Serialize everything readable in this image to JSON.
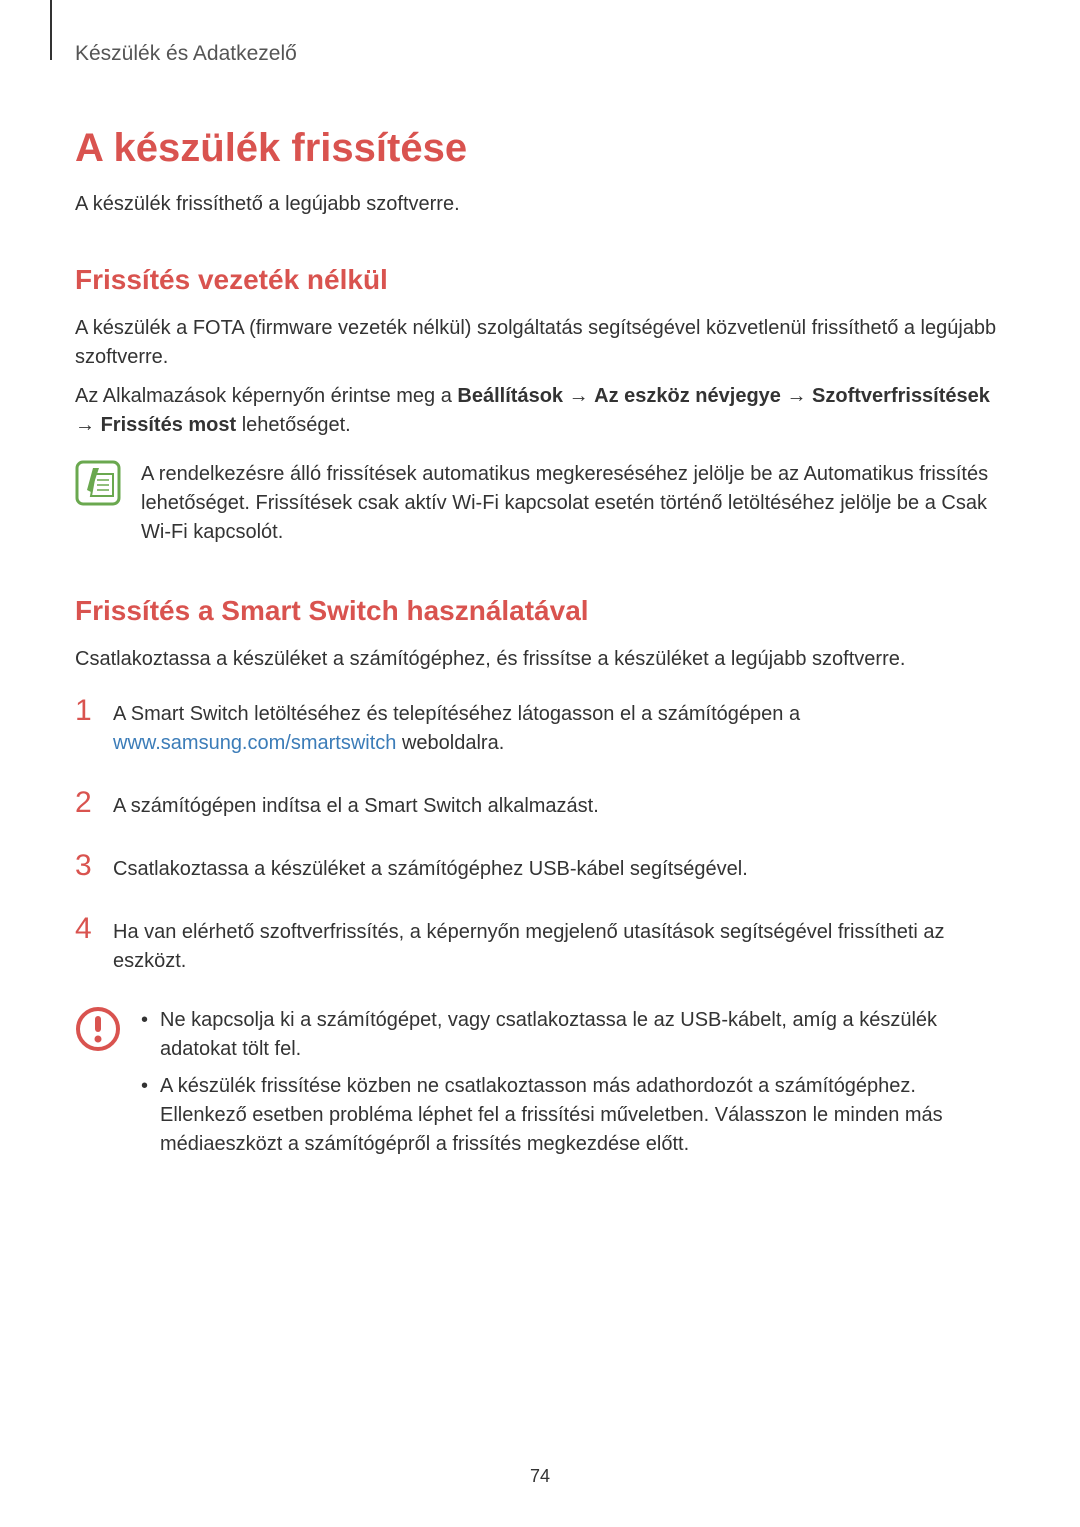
{
  "header": {
    "section": "Készülék és Adatkezelő"
  },
  "title": "A készülék frissítése",
  "intro": "A készülék frissíthető a legújabb szoftverre.",
  "section1": {
    "title": "Frissítés vezeték nélkül",
    "para1": "A készülék a FOTA (firmware vezeték nélkül) szolgáltatás segítségével közvetlenül frissíthető a legújabb szoftverre.",
    "para2_part1": "Az Alkalmazások képernyőn érintse meg a ",
    "para2_bold1": "Beállítások",
    "para2_arrow1": " → ",
    "para2_bold2": "Az eszköz névjegye",
    "para2_arrow2": " → ",
    "para2_bold3": "Szoftverfrissítések",
    "para2_arrow3": " → ",
    "para2_bold4": "Frissítés most",
    "para2_part2": " lehetőséget.",
    "note_part1": "A rendelkezésre álló frissítések automatikus megkereséséhez jelölje be az ",
    "note_bold1": "Automatikus frissítés",
    "note_part2": " lehetőséget. Frissítések csak aktív Wi-Fi kapcsolat esetén történő letöltéséhez jelölje be a ",
    "note_bold2": "Csak Wi-Fi",
    "note_part3": " kapcsolót."
  },
  "section2": {
    "title": "Frissítés a Smart Switch használatával",
    "para1": "Csatlakoztassa a készüléket a számítógéphez, és frissítse a készüléket a legújabb szoftverre.",
    "steps": [
      {
        "num": "1",
        "text_part1": "A Smart Switch letöltéséhez és telepítéséhez látogasson el a számítógépen a ",
        "link": "www.samsung.com/smartswitch",
        "text_part2": " weboldalra."
      },
      {
        "num": "2",
        "text": "A számítógépen indítsa el a Smart Switch alkalmazást."
      },
      {
        "num": "3",
        "text": "Csatlakoztassa a készüléket a számítógéphez USB-kábel segítségével."
      },
      {
        "num": "4",
        "text": "Ha van elérhető szoftverfrissítés, a képernyőn megjelenő utasítások segítségével frissítheti az eszközt."
      }
    ],
    "warnings": [
      "Ne kapcsolja ki a számítógépet, vagy csatlakoztassa le az USB-kábelt, amíg a készülék adatokat tölt fel.",
      "A készülék frissítése közben ne csatlakoztasson más adathordozót a számítógéphez. Ellenkező esetben probléma léphet fel a frissítési műveletben. Válasszon le minden más médiaeszközt a számítógépről a frissítés megkezdése előtt."
    ]
  },
  "page_number": "74"
}
